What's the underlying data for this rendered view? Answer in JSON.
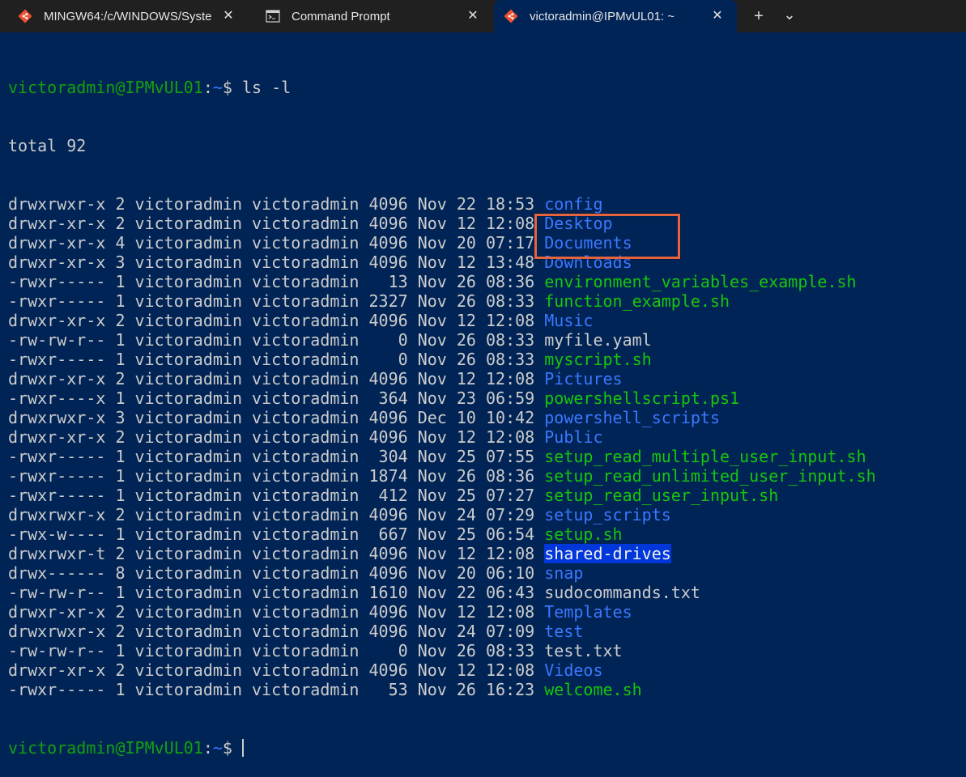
{
  "tabs": [
    {
      "title": "MINGW64:/c/WINDOWS/Syste",
      "icon": "git-bash-icon",
      "active": false
    },
    {
      "title": "Command Prompt",
      "icon": "cmd-icon",
      "active": false
    },
    {
      "title": "victoradmin@IPMvUL01: ~",
      "icon": "git-bash-icon",
      "active": true
    }
  ],
  "tab_close_glyph": "✕",
  "new_tab_glyph": "+",
  "dropdown_glyph": "⌄",
  "prompt": {
    "user": "victoradmin@IPMvUL01",
    "colon": ":",
    "path": "~",
    "symbol": "$"
  },
  "command": " ls -l",
  "total": "total 92",
  "entries": [
    {
      "perms": "drwxrwxr-x",
      "links": "2",
      "owner": "victoradmin",
      "group": "victoradmin",
      "size": "4096",
      "date": "Nov 22 18:53",
      "name": "config",
      "type": "dir"
    },
    {
      "perms": "drwxr-xr-x",
      "links": "2",
      "owner": "victoradmin",
      "group": "victoradmin",
      "size": "4096",
      "date": "Nov 12 12:08",
      "name": "Desktop",
      "type": "dir"
    },
    {
      "perms": "drwxr-xr-x",
      "links": "4",
      "owner": "victoradmin",
      "group": "victoradmin",
      "size": "4096",
      "date": "Nov 20 07:17",
      "name": "Documents",
      "type": "dir"
    },
    {
      "perms": "drwxr-xr-x",
      "links": "3",
      "owner": "victoradmin",
      "group": "victoradmin",
      "size": "4096",
      "date": "Nov 12 13:48",
      "name": "Downloads",
      "type": "dir"
    },
    {
      "perms": "-rwxr-----",
      "links": "1",
      "owner": "victoradmin",
      "group": "victoradmin",
      "size": "13",
      "date": "Nov 26 08:36",
      "name": "environment_variables_example.sh",
      "type": "exe"
    },
    {
      "perms": "-rwxr-----",
      "links": "1",
      "owner": "victoradmin",
      "group": "victoradmin",
      "size": "2327",
      "date": "Nov 26 08:33",
      "name": "function_example.sh",
      "type": "exe"
    },
    {
      "perms": "drwxr-xr-x",
      "links": "2",
      "owner": "victoradmin",
      "group": "victoradmin",
      "size": "4096",
      "date": "Nov 12 12:08",
      "name": "Music",
      "type": "dir"
    },
    {
      "perms": "-rw-rw-r--",
      "links": "1",
      "owner": "victoradmin",
      "group": "victoradmin",
      "size": "0",
      "date": "Nov 26 08:33",
      "name": "myfile.yaml",
      "type": "plain"
    },
    {
      "perms": "-rwxr-----",
      "links": "1",
      "owner": "victoradmin",
      "group": "victoradmin",
      "size": "0",
      "date": "Nov 26 08:33",
      "name": "myscript.sh",
      "type": "exe"
    },
    {
      "perms": "drwxr-xr-x",
      "links": "2",
      "owner": "victoradmin",
      "group": "victoradmin",
      "size": "4096",
      "date": "Nov 12 12:08",
      "name": "Pictures",
      "type": "dir"
    },
    {
      "perms": "-rwxr----x",
      "links": "1",
      "owner": "victoradmin",
      "group": "victoradmin",
      "size": "364",
      "date": "Nov 23 06:59",
      "name": "powershellscript.ps1",
      "type": "exe"
    },
    {
      "perms": "drwxrwxr-x",
      "links": "3",
      "owner": "victoradmin",
      "group": "victoradmin",
      "size": "4096",
      "date": "Dec 10 10:42",
      "name": "powershell_scripts",
      "type": "dir"
    },
    {
      "perms": "drwxr-xr-x",
      "links": "2",
      "owner": "victoradmin",
      "group": "victoradmin",
      "size": "4096",
      "date": "Nov 12 12:08",
      "name": "Public",
      "type": "dir"
    },
    {
      "perms": "-rwxr-----",
      "links": "1",
      "owner": "victoradmin",
      "group": "victoradmin",
      "size": "304",
      "date": "Nov 25 07:55",
      "name": "setup_read_multiple_user_input.sh",
      "type": "exe"
    },
    {
      "perms": "-rwxr-----",
      "links": "1",
      "owner": "victoradmin",
      "group": "victoradmin",
      "size": "1874",
      "date": "Nov 26 08:36",
      "name": "setup_read_unlimited_user_input.sh",
      "type": "exe"
    },
    {
      "perms": "-rwxr-----",
      "links": "1",
      "owner": "victoradmin",
      "group": "victoradmin",
      "size": "412",
      "date": "Nov 25 07:27",
      "name": "setup_read_user_input.sh",
      "type": "exe"
    },
    {
      "perms": "drwxrwxr-x",
      "links": "2",
      "owner": "victoradmin",
      "group": "victoradmin",
      "size": "4096",
      "date": "Nov 24 07:29",
      "name": "setup_scripts",
      "type": "dir"
    },
    {
      "perms": "-rwx-w----",
      "links": "1",
      "owner": "victoradmin",
      "group": "victoradmin",
      "size": "667",
      "date": "Nov 25 06:54",
      "name": "setup.sh",
      "type": "exe"
    },
    {
      "perms": "drwxrwxr-t",
      "links": "2",
      "owner": "victoradmin",
      "group": "victoradmin",
      "size": "4096",
      "date": "Nov 12 12:08",
      "name": "shared-drives",
      "type": "hl"
    },
    {
      "perms": "drwx------",
      "links": "8",
      "owner": "victoradmin",
      "group": "victoradmin",
      "size": "4096",
      "date": "Nov 20 06:10",
      "name": "snap",
      "type": "dir"
    },
    {
      "perms": "-rw-rw-r--",
      "links": "1",
      "owner": "victoradmin",
      "group": "victoradmin",
      "size": "1610",
      "date": "Nov 22 06:43",
      "name": "sudocommands.txt",
      "type": "plain"
    },
    {
      "perms": "drwxr-xr-x",
      "links": "2",
      "owner": "victoradmin",
      "group": "victoradmin",
      "size": "4096",
      "date": "Nov 12 12:08",
      "name": "Templates",
      "type": "dir"
    },
    {
      "perms": "drwxrwxr-x",
      "links": "2",
      "owner": "victoradmin",
      "group": "victoradmin",
      "size": "4096",
      "date": "Nov 24 07:09",
      "name": "test",
      "type": "dir"
    },
    {
      "perms": "-rw-rw-r--",
      "links": "1",
      "owner": "victoradmin",
      "group": "victoradmin",
      "size": "0",
      "date": "Nov 26 08:33",
      "name": "test.txt",
      "type": "plain"
    },
    {
      "perms": "drwxr-xr-x",
      "links": "2",
      "owner": "victoradmin",
      "group": "victoradmin",
      "size": "4096",
      "date": "Nov 12 12:08",
      "name": "Videos",
      "type": "dir"
    },
    {
      "perms": "-rwxr-----",
      "links": "1",
      "owner": "victoradmin",
      "group": "victoradmin",
      "size": "53",
      "date": "Nov 26 16:23",
      "name": "welcome.sh",
      "type": "exe"
    }
  ],
  "colors": {
    "background": "#012456",
    "prompt_user": "#13a10e",
    "prompt_path": "#3b78ff",
    "directory": "#3b78ff",
    "executable": "#16c60c",
    "plain_text": "#cccccc",
    "highlight_bg": "#0037da",
    "annotation_box": "#e5643e"
  }
}
